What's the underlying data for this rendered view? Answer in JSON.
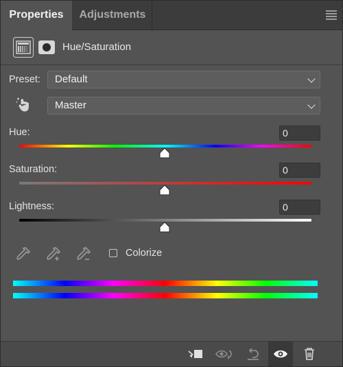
{
  "tabs": [
    {
      "label": "Properties",
      "active": true
    },
    {
      "label": "Adjustments",
      "active": false
    }
  ],
  "header": {
    "title": "Hue/Saturation",
    "adjustment_icon": "hue-saturation-layer-icon",
    "mask_icon": "layer-mask-icon"
  },
  "preset": {
    "label": "Preset:",
    "value": "Default"
  },
  "channel": {
    "value": "Master",
    "tool_icon": "targeted-adjustment-hand-icon"
  },
  "sliders": {
    "hue": {
      "label": "Hue:",
      "value": "0"
    },
    "saturation": {
      "label": "Saturation:",
      "value": "0"
    },
    "lightness": {
      "label": "Lightness:",
      "value": "0"
    }
  },
  "eyedroppers": [
    "eyedropper-icon",
    "eyedropper-add-icon",
    "eyedropper-subtract-icon"
  ],
  "colorize": {
    "label": "Colorize",
    "checked": false
  },
  "footer_buttons": [
    "clip-to-layer-icon",
    "view-previous-state-icon",
    "reset-icon",
    "visibility-eye-icon",
    "trash-icon"
  ],
  "colors": {
    "panel_bg": "#535353",
    "tab_bar_bg": "#3c3c3c",
    "field_bg": "#3d3d3d",
    "dropdown_bg": "#5d5d5d"
  }
}
